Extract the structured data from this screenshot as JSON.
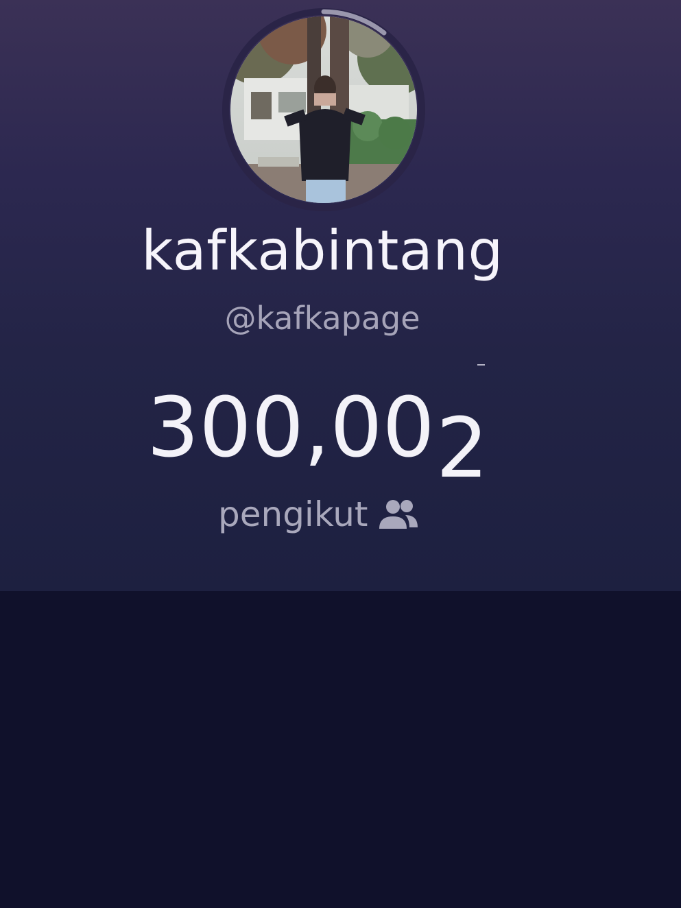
{
  "profile": {
    "display_name": "kafkabintang",
    "handle": "@kafkapage",
    "avatar_alt": "profile photo"
  },
  "followers": {
    "count_prefix": "300,00",
    "count_last_digit": "2",
    "label": "pengikut",
    "icon": "people-icon"
  },
  "colors": {
    "card_top": "#3b3156",
    "card_bottom": "#1d2040",
    "page_bg": "#10112b",
    "text_primary": "#f6f4fb",
    "text_secondary": "#a6a4b9"
  }
}
